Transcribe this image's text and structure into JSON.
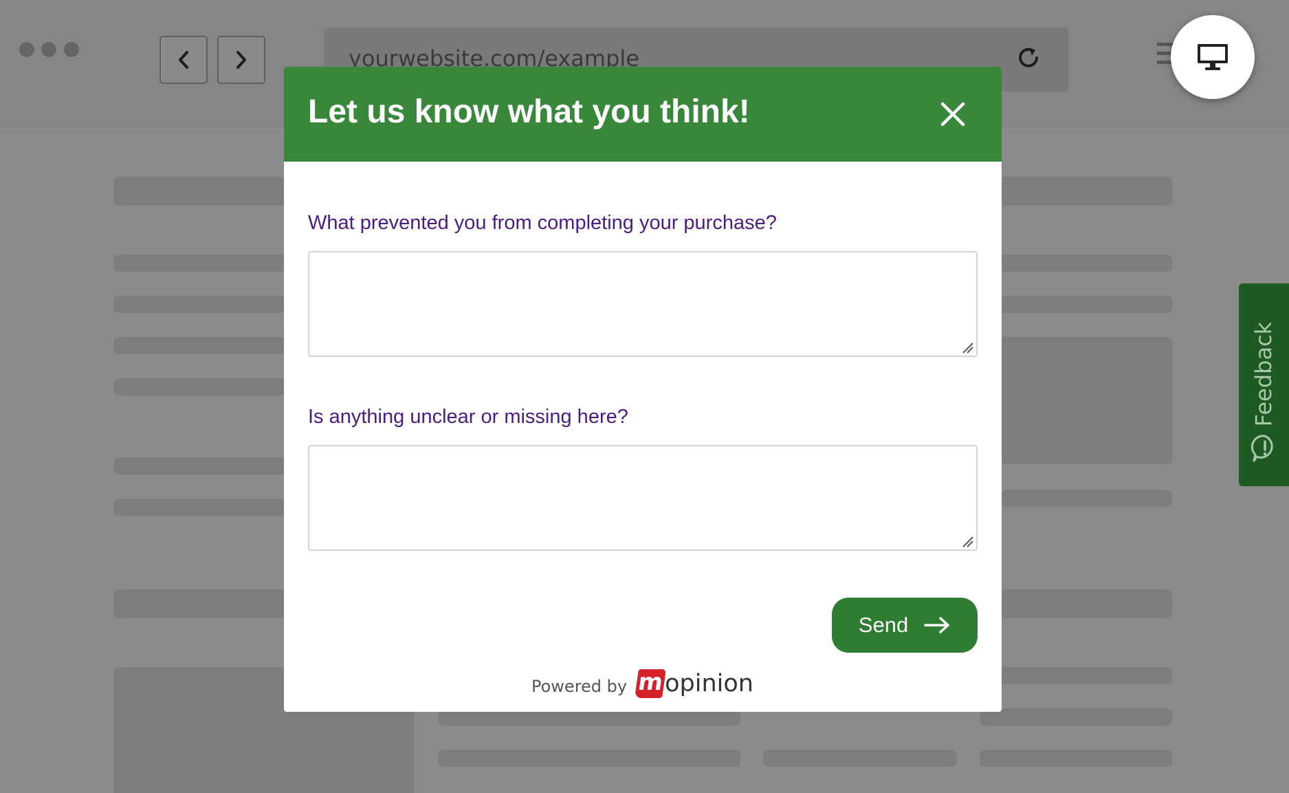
{
  "browser": {
    "url": "yourwebsite.com/example"
  },
  "modal": {
    "title": "Let us know what you think!",
    "questions": [
      {
        "label": "What prevented you from completing your purchase?",
        "value": ""
      },
      {
        "label": "Is anything unclear or missing here?",
        "value": ""
      }
    ],
    "send_label": "Send",
    "powered_by": "Powered by",
    "brand_rest": "opinion",
    "brand_initial": "m"
  },
  "feedback_tab": {
    "label": "Feedback"
  },
  "colors": {
    "header_green": "#38873b",
    "button_green": "#2f7d32",
    "question_purple": "#4b1c82",
    "brand_red": "#d6202a"
  }
}
